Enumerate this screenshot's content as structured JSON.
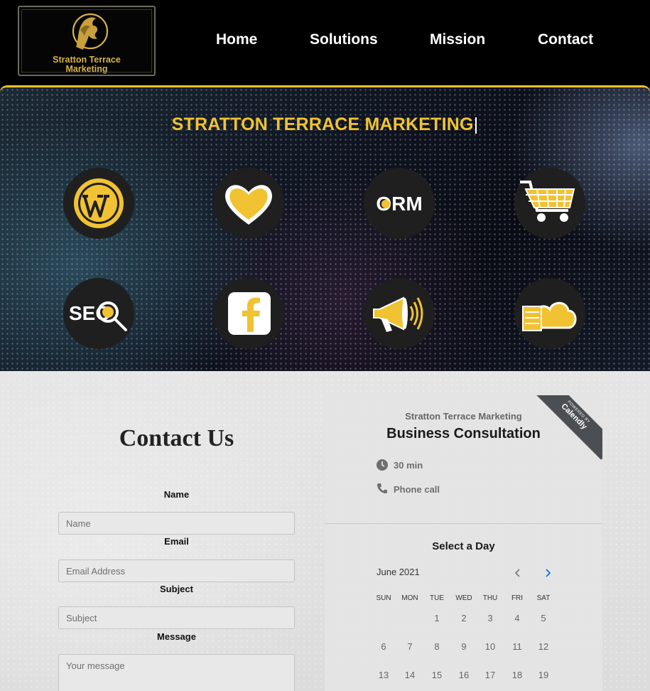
{
  "header": {
    "logo_line1": "Stratton Terrace",
    "logo_line2": "Marketing",
    "nav": [
      "Home",
      "Solutions",
      "Mission",
      "Contact"
    ]
  },
  "hero": {
    "title": "STRATTON TERRACE MARKETING",
    "cursor": "|",
    "orm_text": "ORM",
    "seo_text": "SEO",
    "icons": [
      "wordpress-icon",
      "heart-icon",
      "orm-icon",
      "shopping-cart-icon",
      "seo-search-icon",
      "facebook-icon",
      "megaphone-icon",
      "cloud-server-icon"
    ]
  },
  "contact": {
    "title": "Contact Us",
    "name_label": "Name",
    "name_placeholder": "Name",
    "email_label": "Email",
    "email_placeholder": "Email Address",
    "subject_label": "Subject",
    "subject_placeholder": "Subject",
    "message_label": "Message",
    "message_placeholder": "Your message"
  },
  "calendly": {
    "ribbon_small": "POWERED BY",
    "ribbon_big": "Calendly",
    "organizer": "Stratton Terrace Marketing",
    "event": "Business Consultation",
    "duration": "30 min",
    "location": "Phone call",
    "select_day": "Select a Day",
    "month": "June 2021",
    "weekdays": [
      "SUN",
      "MON",
      "TUE",
      "WED",
      "THU",
      "FRI",
      "SAT"
    ],
    "week1": [
      "",
      "",
      "1",
      "2",
      "3",
      "4",
      "5"
    ],
    "week2": [
      "6",
      "7",
      "8",
      "9",
      "10",
      "11",
      "12"
    ],
    "week3": [
      "13",
      "14",
      "15",
      "16",
      "17",
      "18",
      "19"
    ]
  },
  "colors": {
    "gold": "#f1c232",
    "dark": "#1f1f1f",
    "accent_blue": "#0069ff"
  }
}
